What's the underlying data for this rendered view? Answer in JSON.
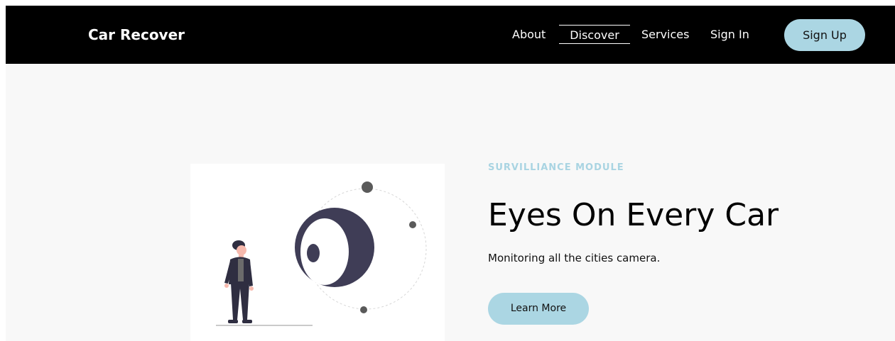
{
  "nav": {
    "brand": "Car Recover",
    "links": [
      {
        "label": "About"
      },
      {
        "label": "Discover"
      },
      {
        "label": "Services"
      },
      {
        "label": "Sign In"
      }
    ],
    "signup_label": "Sign Up"
  },
  "hero": {
    "eyebrow": "SURVILLIANCE MODULE",
    "headline": "Eyes On Every Car",
    "subtext": "Monitoring all the cities camera.",
    "cta_label": "Learn More",
    "illustration": "person-watching-surveillance-eye-illustration"
  },
  "colors": {
    "navbar_bg": "#000000",
    "accent": "#abd6e3",
    "eyebrow": "#a9d4e2",
    "hero_bg": "#f8f8f8",
    "eye_dark": "#3f3d56"
  }
}
